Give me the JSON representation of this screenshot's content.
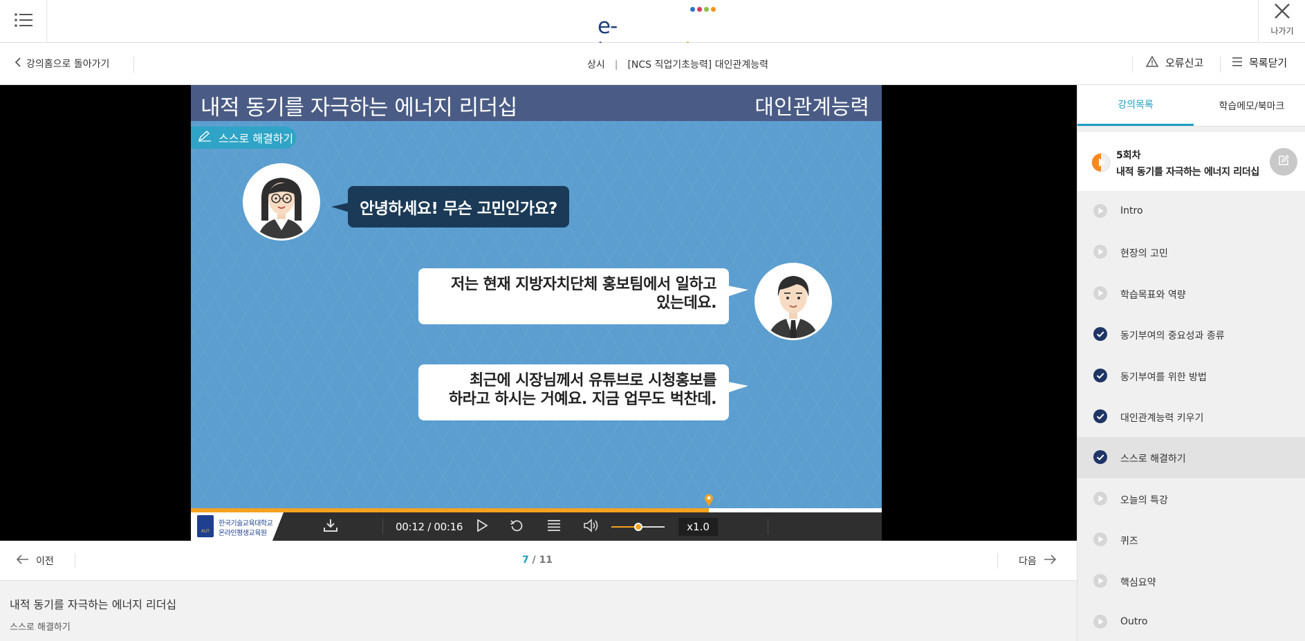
{
  "header": {
    "logo": {
      "part1": "e-korea",
      "part2": "tech",
      "dots": [
        "#2b74c7",
        "#d83b5d",
        "#8bc34a",
        "#f7931e"
      ]
    },
    "exit_label": "나가기"
  },
  "subbar": {
    "back_label": "강의홈으로 돌아가기",
    "course_type": "상시",
    "course_name": "[NCS 직업기초능력] 대인관계능력",
    "report_label": "오류신고",
    "close_list_label": "목록닫기"
  },
  "slide": {
    "title": "내적 동기를 자극하는 에너지 리더십",
    "subject": "대인관계능력",
    "tag": "스스로 해결하기",
    "bubble1": "안녕하세요! 무슨 고민인가요?",
    "bubble2_line1": "저는 현재 지방자치단체 홍보팀에서 일하고",
    "bubble2_line2": "있는데요.",
    "bubble3_line1": "최근에 시장님께서 유튜브로 시청홍보를",
    "bubble3_line2": "하라고 하시는 거예요. 지금 업무도 벅찬데."
  },
  "player": {
    "org_line1": "한국기술교육대학교",
    "org_line2": "온라인평생교육원",
    "time": "00:12 / 00:16",
    "speed": "x1.0",
    "progress_fraction": 0.75,
    "volume_fraction": 0.5,
    "accent": "#f5a21e"
  },
  "nav": {
    "prev_label": "이전",
    "next_label": "다음",
    "current_page": "7",
    "page_sep": " / ",
    "total_pages": "11"
  },
  "lesson": {
    "title": "내적 동기를 자극하는 에너지 리더십",
    "subtitle": "스스로 해결하기"
  },
  "sidebar": {
    "tabs": [
      {
        "label": "강의목록",
        "active": true
      },
      {
        "label": "학습메모/북마크",
        "active": false
      }
    ],
    "chapter_num": "5회차",
    "chapter_title": "내적 동기를 자극하는 에너지 리더십",
    "items": [
      {
        "label": "Intro",
        "status": "play"
      },
      {
        "label": "현장의 고민",
        "status": "play"
      },
      {
        "label": "학습목표와 역량",
        "status": "play"
      },
      {
        "label": "동기부여의 중요성과 종류",
        "status": "done"
      },
      {
        "label": "동기부여를 위한 방법",
        "status": "done"
      },
      {
        "label": "대인관계능력 키우기",
        "status": "done"
      },
      {
        "label": "스스로 해결하기",
        "status": "done",
        "active": true
      },
      {
        "label": "오늘의 특강",
        "status": "play"
      },
      {
        "label": "퀴즈",
        "status": "play"
      },
      {
        "label": "핵심요약",
        "status": "play"
      },
      {
        "label": "Outro",
        "status": "play"
      }
    ]
  }
}
